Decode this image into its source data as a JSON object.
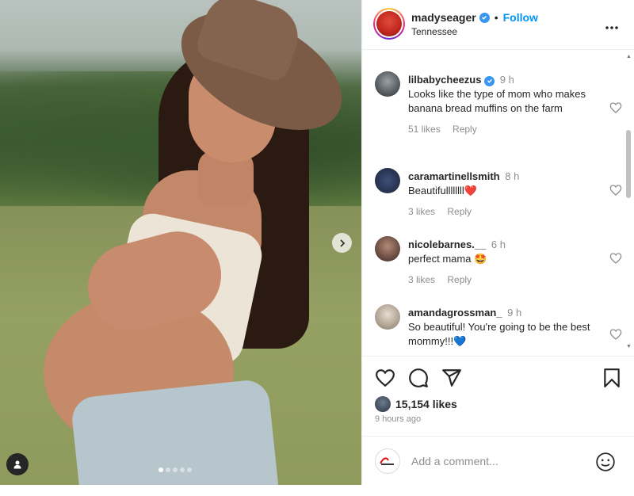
{
  "post": {
    "username": "madyseager",
    "follow_label": "Follow",
    "separator": "•",
    "location": "Tennessee",
    "more_icon": "more-horizontal-icon",
    "carousel": {
      "total_images": 5,
      "active_index": 0,
      "next_icon": "chevron-right-icon"
    }
  },
  "comments": [
    {
      "username": "lilbabycheezus",
      "verified": true,
      "time": "9 h",
      "text": "Looks like the type of mom who makes banana bread muffins on the farm",
      "likes": "51 likes",
      "reply": "Reply"
    },
    {
      "username": "caramartinellsmith",
      "verified": false,
      "time": "8 h",
      "text": "Beautifullllllll❤️",
      "likes": "3 likes",
      "reply": "Reply"
    },
    {
      "username": "nicolebarnes.__",
      "verified": false,
      "time": "6 h",
      "text": "perfect mama 🤩",
      "likes": "3 likes",
      "reply": "Reply"
    },
    {
      "username": "amandagrossman_",
      "verified": false,
      "time": "9 h",
      "text": "So beautiful! You're going to be the best mommy!!!💙",
      "likes": "",
      "reply": ""
    }
  ],
  "actions": {
    "like_icon": "heart-icon",
    "comment_icon": "comment-icon",
    "share_icon": "send-icon",
    "save_icon": "bookmark-icon",
    "likes_count": "15,154 likes",
    "time_ago": "9 hours ago"
  },
  "add_comment": {
    "placeholder": "Add a comment...",
    "emoji_icon": "emoji-smile-icon"
  },
  "colors": {
    "accent": "#0095f6",
    "verified": "#3897f0",
    "text": "#262626",
    "muted": "#8e8e8e"
  }
}
